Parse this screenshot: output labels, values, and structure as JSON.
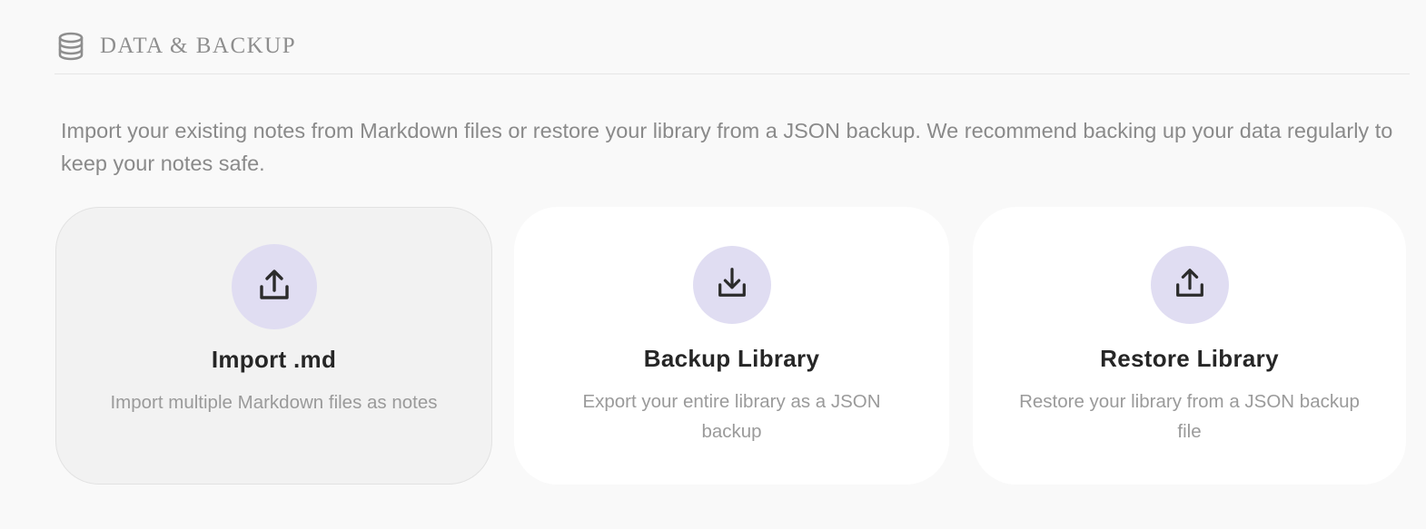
{
  "section": {
    "title": "DATA & BACKUP",
    "icon": "database-icon"
  },
  "description": "Import your existing notes from Markdown files or restore your library from a JSON backup. We recommend backing up your data regularly to keep your notes safe.",
  "cards": [
    {
      "title": "Import .md",
      "description": "Import multiple Markdown files as notes",
      "icon": "upload-icon"
    },
    {
      "title": "Backup Library",
      "description": "Export your entire library as a JSON backup",
      "icon": "download-icon"
    },
    {
      "title": "Restore Library",
      "description": "Restore your library from a JSON backup file",
      "icon": "upload-icon"
    }
  ],
  "colors": {
    "background": "#f9f9f9",
    "card": "#ffffff",
    "card_hover": "#f2f2f2",
    "icon_circle": "#e0ddf2",
    "title_text": "#262626",
    "muted_text": "#8a8a8a"
  }
}
